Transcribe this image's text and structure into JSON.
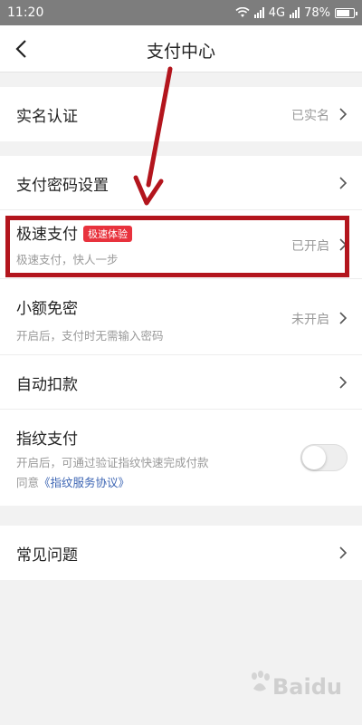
{
  "status_bar": {
    "time": "11:20",
    "network": "4G",
    "battery": "78%"
  },
  "nav": {
    "title": "支付中心"
  },
  "rows": {
    "real_name": {
      "title": "实名认证",
      "value": "已实名"
    },
    "pay_password": {
      "title": "支付密码设置"
    },
    "express_pay": {
      "title": "极速支付",
      "badge": "极速体验",
      "subtitle": "极速支付，快人一步",
      "value": "已开启"
    },
    "small_amount": {
      "title": "小额免密",
      "subtitle": "开启后，支付时无需输入密码",
      "value": "未开启"
    },
    "auto_deduct": {
      "title": "自动扣款"
    },
    "fingerprint": {
      "title": "指纹支付",
      "subtitle": "开启后，可通过验证指纹快速完成付款",
      "agree_prefix": "同意",
      "agree_link": "《指纹服务协议》",
      "enabled": false
    },
    "faq": {
      "title": "常见问题"
    }
  },
  "watermark": {
    "text": "Baidu"
  },
  "colors": {
    "accent_red": "#e8323d",
    "annotation_red": "#b3151d",
    "link_blue": "#3b64b3"
  }
}
